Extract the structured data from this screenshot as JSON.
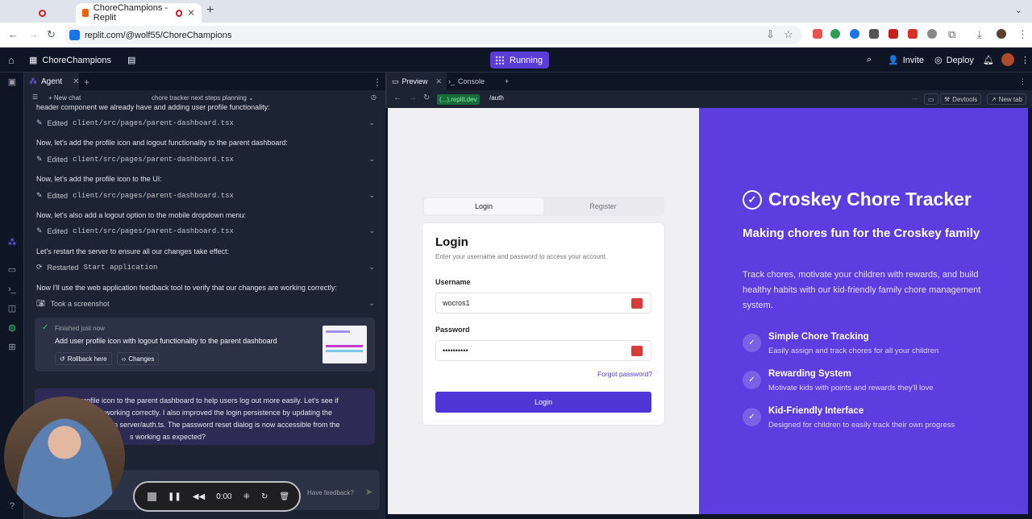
{
  "browser": {
    "active_tab_title": "ChoreChampions - Replit",
    "url": "replit.com/@wolf55/ChoreChampions"
  },
  "replit": {
    "project_name": "ChoreChampions",
    "status": "Running",
    "invite": "Invite",
    "deploy": "Deploy"
  },
  "agent": {
    "tab_label": "Agent",
    "new_chat": "New chat",
    "chat_title": "chore tracker next steps planning",
    "messages": {
      "m0": "header component we already have and adding user profile functionality:",
      "f1_prefix": "Edited",
      "f1_path": "client/src/pages/parent-dashboard.tsx",
      "m1": "Now, let's add the profile icon and logout functionality to the parent dashboard:",
      "f2_prefix": "Edited",
      "f2_path": "client/src/pages/parent-dashboard.tsx",
      "m2": "Now, let's add the profile icon to the UI:",
      "f3_prefix": "Edited",
      "f3_path": "client/src/pages/parent-dashboard.tsx",
      "m3": "Now, let's also add a logout option to the mobile dropdown menu:",
      "f4_prefix": "Edited",
      "f4_path": "client/src/pages/parent-dashboard.tsx",
      "m4": "Let's restart the server to ensure all our changes take effect:",
      "f5_prefix": "Restarted",
      "f5_path": "Start application",
      "m5": "Now I'll use the web application feedback tool to verify that our changes are working correctly:",
      "f6_prefix": "Took a screenshot"
    },
    "finished": {
      "status": "Finished just now",
      "title": "Add user profile icon with logout functionality to the parent dashboard",
      "rollback": "Rollback here",
      "changes": "Changes"
    },
    "reply_lines": [
      "profile icon to the parent dashboard to help users log out more easily. Let's see if",
      "is working correctly. I also improved the login persistence by updating the",
      "in server/auth.ts. The password reset dialog is now accessible from the",
      "s working as expected?"
    ],
    "feedback": "Have feedback?"
  },
  "player": {
    "time": "0:00"
  },
  "preview": {
    "tab_preview": "Preview",
    "tab_console": "Console",
    "url_host": "(...).replit.dev",
    "url_path": "/auth",
    "devtools": "Devtools",
    "new_tab": "New tab"
  },
  "auth": {
    "tab_login": "Login",
    "tab_register": "Register",
    "heading": "Login",
    "description": "Enter your username and password to access your account.",
    "username_label": "Username",
    "username_value": "wocros1",
    "password_label": "Password",
    "password_value": "••••••••••",
    "forgot": "Forgot password?",
    "submit": "Login"
  },
  "hero": {
    "title": "Croskey Chore Tracker",
    "subtitle": "Making chores fun for the Croskey family",
    "description": "Track chores, motivate your children with rewards, and build healthy habits with our kid-friendly family chore management system.",
    "features": [
      {
        "title": "Simple Chore Tracking",
        "desc": "Easily assign and track chores for all your children"
      },
      {
        "title": "Rewarding System",
        "desc": "Motivate kids with points and rewards they'll love"
      },
      {
        "title": "Kid-Friendly Interface",
        "desc": "Designed for children to easily track their own progress"
      }
    ]
  },
  "colors": {
    "accent": "#5b3de0",
    "button": "#5036d6",
    "running": "#5a3dd6"
  }
}
